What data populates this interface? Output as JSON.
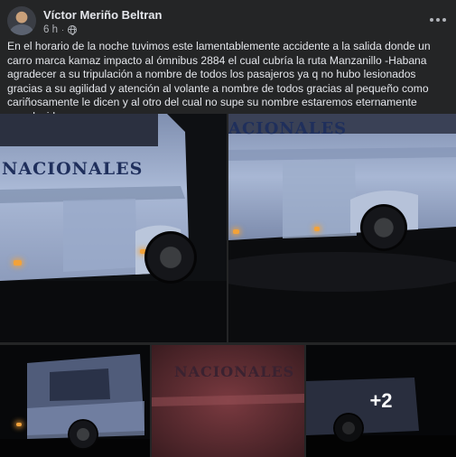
{
  "post": {
    "author": "Víctor Meriño Beltran",
    "time": "6 h",
    "separator": "·",
    "privacy_icon": "globe-icon",
    "more_icon": "more-options-icon",
    "text": "En el horario de la noche tuvimos este lamentablemente accidente a la salida donde un carro marca kamaz impacto al ómnibus 2884 el cual cubría la ruta Manzanillo -Habana agradecer a su tripulación a nombre de todos los pasajeros ya q no hubo lesionados gracias a su agilidad y atención al volante a nombre de todos gracias al pequeño como cariñosamente le dicen y al otro del cual no supe su nombre estaremos eternamente agradecidos"
  },
  "photos": {
    "photo1_text": "NACIONALES",
    "photo2_text": "ACIONALES",
    "photo4_text": "NACIONALES",
    "more_count": "+2"
  },
  "colors": {
    "background": "#242526",
    "text_primary": "#e4e6eb",
    "text_secondary": "#b0b3b8",
    "bus_body": "#9fb3d6"
  }
}
